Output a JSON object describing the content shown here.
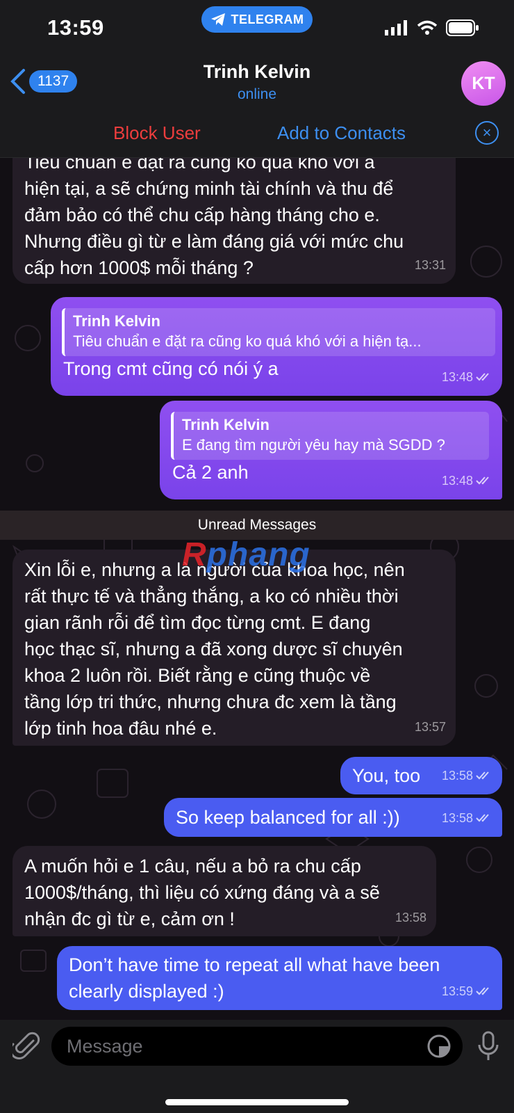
{
  "status_bar": {
    "time": "13:59",
    "app_pill": "TELEGRAM"
  },
  "header": {
    "back_count": "1137",
    "contact_name": "Trinh Kelvin",
    "status": "online",
    "avatar_initials": "KT"
  },
  "actions": {
    "block": "Block User",
    "add": "Add to Contacts"
  },
  "messages": [
    {
      "dir": "in",
      "lines": [
        "Tiêu chuẩn e đặt ra cũng ko quá khó với a",
        "hiện tại, a sẽ chứng minh tài chính và thu để",
        "đảm bảo có thể chu cấp hàng tháng cho e.",
        "Nhưng điều gì từ e làm đáng giá với mức chu",
        "cấp hơn 1000$ mỗi tháng ?"
      ],
      "time": "13:31"
    },
    {
      "dir": "out",
      "reply_name": "Trinh Kelvin",
      "reply_text": "Tiêu chuẩn e đặt ra cũng ko quá khó với a hiện tạ...",
      "text": "Trong cmt cũng có nói ý a",
      "time": "13:48"
    },
    {
      "dir": "out",
      "reply_name": "Trinh Kelvin",
      "reply_text": "E đang tìm người yêu hay mà SGDD ?",
      "text": "Cả 2 anh",
      "time": "13:48"
    },
    {
      "dir": "in",
      "lines": [
        "Xin lỗi e, nhưng a là người của khoa học, nên",
        "rất thực tế và thẳng thắng, a ko có nhiều thời",
        "gian rãnh rỗi để tìm đọc từng cmt. E đang",
        "học thạc sĩ, nhưng a đã xong dược sĩ chuyên",
        "khoa 2 luôn rồi. Biết rằng e cũng thuộc về",
        "tầng lớp tri thức, nhưng chưa đc xem là tầng",
        "lớp tinh hoa đâu nhé e."
      ],
      "time": "13:57"
    },
    {
      "dir": "out",
      "text": "You, too",
      "time": "13:58"
    },
    {
      "dir": "out",
      "text": "So keep balanced for all :))",
      "time": "13:58"
    },
    {
      "dir": "in",
      "lines": [
        "A muốn hỏi e 1 câu, nếu a bỏ ra chu cấp",
        "1000$/tháng, thì liệu có xứng đáng và a sẽ",
        "nhận đc gì từ e, cảm ơn !"
      ],
      "time": "13:58"
    },
    {
      "dir": "out",
      "lines": [
        "Don’t have time to repeat all what have been",
        "clearly displayed :)"
      ],
      "time": "13:59"
    }
  ],
  "divider": "Unread Messages",
  "watermark": {
    "left": "R",
    "right": "phang"
  },
  "composer": {
    "placeholder": "Message"
  }
}
